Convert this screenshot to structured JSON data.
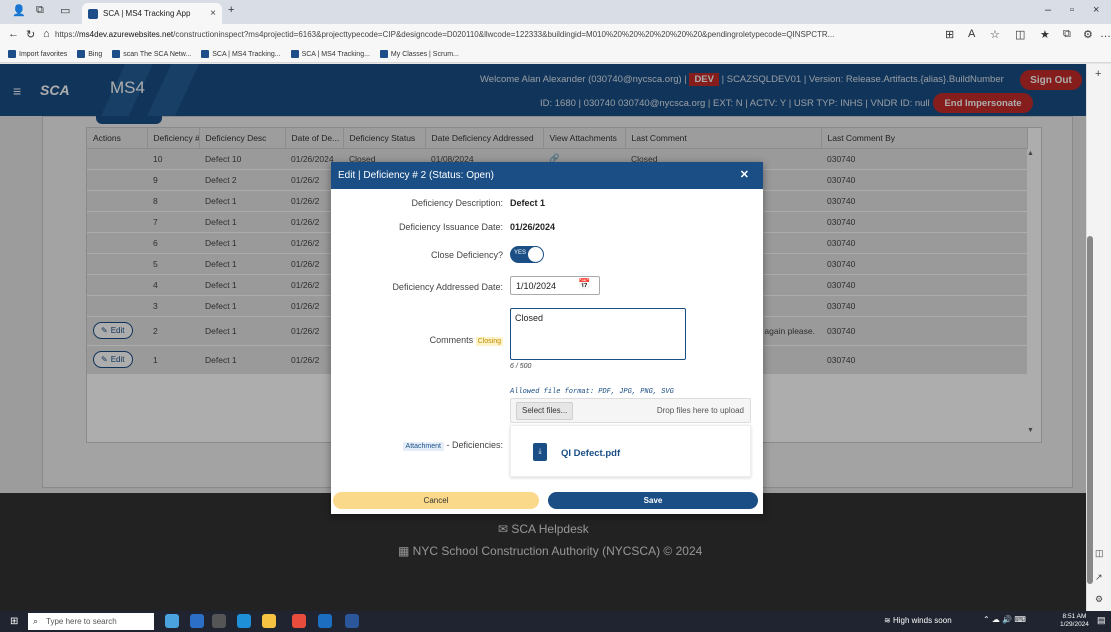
{
  "browser": {
    "tab_title": "SCA | MS4 Tracking App",
    "url_prefix": "https://",
    "url_host": "ms4dev.azurewebsites.net",
    "url_rest": "/constructioninspect?ms4projectid=6163&projecttypecode=CIP&designcode=D020110&llwcode=122333&buildingid=M010%20%20%20%20%20%20&pendingroletypecode=QINSPCTR...",
    "favorites": [
      "Import favorites",
      "Bing",
      "scan The SCA Netw...",
      "SCA | MS4 Tracking...",
      "SCA | MS4 Tracking...",
      "My Classes | Scrum..."
    ]
  },
  "header": {
    "logo_text": "SCA",
    "app_name": "MS4",
    "welcome": "Welcome Alan Alexander (030740@nycsca.org) |",
    "env_badge": "DEV",
    "env_info": "| SCAZSQLDEV01 | Version: Release.Artifacts.{alias}.BuildNumber",
    "sign_out": "Sign Out",
    "id_line": "ID: 1680 | 030740 030740@nycsca.org | EXT: N | ACTV: Y | USR TYP: INHS | VNDR ID: null",
    "end_impersonate": "End Impersonate"
  },
  "table": {
    "columns": [
      "Actions",
      "Deficiency #",
      "Deficiency Desc",
      "Date of De...",
      "Deficiency Status",
      "Date Deficiency Addressed",
      "View Attachments",
      "Last Comment",
      "Last Comment By"
    ],
    "rows": [
      {
        "num": "10",
        "desc": "Defect 10",
        "date": "01/26/2024",
        "status": "Closed",
        "addressed": "01/08/2024",
        "comment": "Closed",
        "by": "030740",
        "edit": false
      },
      {
        "num": "9",
        "desc": "Defect 2",
        "date": "01/26/2",
        "status": "",
        "addressed": "",
        "comment": "",
        "by": "030740",
        "edit": false
      },
      {
        "num": "8",
        "desc": "Defect 1",
        "date": "01/26/2",
        "status": "",
        "addressed": "",
        "comment": "",
        "by": "030740",
        "edit": false
      },
      {
        "num": "7",
        "desc": "Defect 1",
        "date": "01/26/2",
        "status": "",
        "addressed": "",
        "comment": "",
        "by": "030740",
        "edit": false
      },
      {
        "num": "6",
        "desc": "Defect 1",
        "date": "01/26/2",
        "status": "",
        "addressed": "",
        "comment": "",
        "by": "030740",
        "edit": false
      },
      {
        "num": "5",
        "desc": "Defect 1",
        "date": "01/26/2",
        "status": "",
        "addressed": "",
        "comment": "",
        "by": "030740",
        "edit": false
      },
      {
        "num": "4",
        "desc": "Defect 1",
        "date": "01/26/2",
        "status": "",
        "addressed": "",
        "comment": "",
        "by": "030740",
        "edit": false
      },
      {
        "num": "3",
        "desc": "Defect 1",
        "date": "01/26/2",
        "status": "",
        "addressed": "",
        "comment": "",
        "by": "030740",
        "edit": false
      },
      {
        "num": "2",
        "desc": "Defect 1",
        "date": "01/26/2",
        "status": "",
        "addressed": "",
        "comment": "again please.",
        "by": "030740",
        "edit": true
      },
      {
        "num": "1",
        "desc": "Defect 1",
        "date": "01/26/2",
        "status": "",
        "addressed": "",
        "comment": "",
        "by": "030740",
        "edit": true
      }
    ],
    "edit_label": "Edit"
  },
  "footer": {
    "helpdesk": "SCA Helpdesk",
    "copyright": "NYC School Construction Authority (NYCSCA) © 2024"
  },
  "modal": {
    "title": "Edit | Deficiency # 2 (Status: Open)",
    "desc_label": "Deficiency Description:",
    "desc_value": "Defect 1",
    "issuance_label": "Deficiency Issuance Date:",
    "issuance_value": "01/26/2024",
    "close_label": "Close Deficiency?",
    "toggle_text": "YES",
    "addressed_label": "Deficiency Addressed Date:",
    "addressed_value": "1/10/2024",
    "comments_label": "Comments",
    "closing_tag": "Closing",
    "comments_value": "Closed",
    "counter": "6 / 500",
    "allowed_formats": "Allowed file format: PDF, JPG, PNG, SVG",
    "select_files": "Select files...",
    "drop_hint": "Drop files here to upload",
    "attachment_tag": "Attachment",
    "attachment_label": "- Deficiencies:",
    "file_name": "QI Defect.pdf",
    "cancel": "Cancel",
    "save": "Save"
  },
  "taskbar": {
    "search_placeholder": "Type here to search",
    "weather": "High winds soon",
    "time": "8:51 AM",
    "date": "1/29/2024"
  },
  "colors": {
    "primary": "#1a4e85",
    "danger": "#c62b2b",
    "cancel": "#fbd98a"
  }
}
